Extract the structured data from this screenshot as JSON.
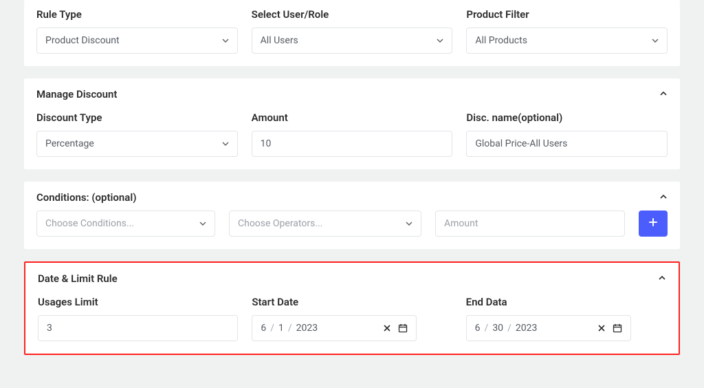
{
  "section1": {
    "ruleType": {
      "label": "Rule Type",
      "value": "Product Discount"
    },
    "userRole": {
      "label": "Select User/Role",
      "value": "All Users"
    },
    "productFilter": {
      "label": "Product Filter",
      "value": "All Products"
    }
  },
  "section2": {
    "title": "Manage Discount",
    "discountType": {
      "label": "Discount Type",
      "value": "Percentage"
    },
    "amount": {
      "label": "Amount",
      "value": "10"
    },
    "discName": {
      "label": "Disc. name(optional)",
      "value": "Global Price-All Users"
    }
  },
  "section3": {
    "title": "Conditions: (optional)",
    "conditions": {
      "placeholder": "Choose Conditions..."
    },
    "operators": {
      "placeholder": "Choose Operators..."
    },
    "amount": {
      "placeholder": "Amount"
    }
  },
  "section4": {
    "title": "Date & Limit Rule",
    "usages": {
      "label": "Usages Limit",
      "value": "3"
    },
    "startDate": {
      "label": "Start Date",
      "month": "6",
      "day": "1",
      "year": "2023"
    },
    "endDate": {
      "label": "End Data",
      "month": "6",
      "day": "30",
      "year": "2023"
    },
    "sep": "/"
  }
}
